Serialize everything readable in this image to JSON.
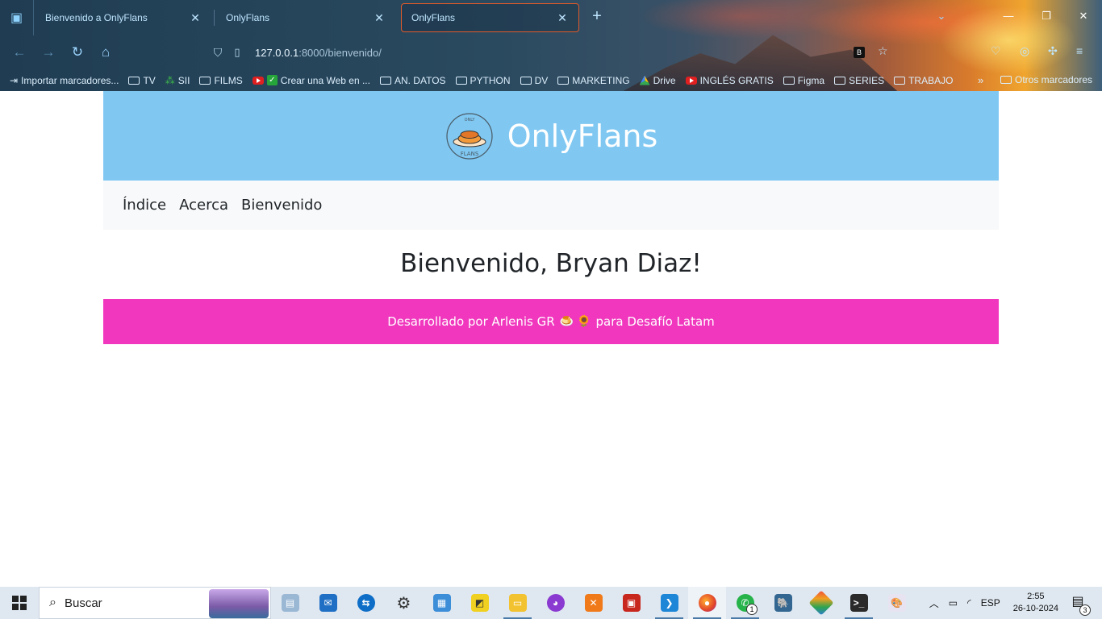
{
  "browser": {
    "tabs": [
      {
        "title": "Bienvenido a OnlyFlans",
        "active": false
      },
      {
        "title": "OnlyFlans",
        "active": false
      },
      {
        "title": "OnlyFlans",
        "active": true
      }
    ],
    "url_host": "127.0.0.1",
    "url_rest": ":8000/bienvenido/",
    "bookmarks": [
      {
        "label": "Importar marcadores...",
        "icon": "import-icon"
      },
      {
        "label": "TV",
        "icon": "folder-icon"
      },
      {
        "label": "SII",
        "icon": "sii-icon"
      },
      {
        "label": "FILMS",
        "icon": "folder-icon"
      },
      {
        "label": "Crear una Web en ...",
        "icon": "youtube-icon"
      },
      {
        "label": "AN. DATOS",
        "icon": "folder-icon"
      },
      {
        "label": "PYTHON",
        "icon": "folder-icon"
      },
      {
        "label": "DV",
        "icon": "folder-icon"
      },
      {
        "label": "MARKETING",
        "icon": "folder-icon"
      },
      {
        "label": "Drive",
        "icon": "drive-icon"
      },
      {
        "label": "INGLÉS GRATIS",
        "icon": "youtube-icon"
      },
      {
        "label": "Figma",
        "icon": "folder-icon"
      },
      {
        "label": "SERIES",
        "icon": "folder-icon"
      },
      {
        "label": "TRABAJO",
        "icon": "folder-icon"
      }
    ],
    "other_bookmarks": "Otros marcadores"
  },
  "site": {
    "brand": "OnlyFlans",
    "logo_top_text": "ONLY",
    "logo_bottom_text": "FLANS",
    "nav": [
      "Índice",
      "Acerca",
      "Bienvenido"
    ],
    "welcome": "Bienvenido, Bryan Diaz!",
    "footer_prefix": "Desarrollado por Arlenis GR",
    "footer_suffix": "para Desafío Latam"
  },
  "taskbar": {
    "search_placeholder": "Buscar",
    "whatsapp_badge": "1",
    "language": "ESP",
    "time": "2:55",
    "date": "26-10-2024",
    "notifications": "3"
  },
  "colors": {
    "header_bg": "#80c8f2",
    "footer_bg": "#f037be",
    "menu_bg": "#f8f9fa",
    "active_tab_border": "#e05a2a"
  }
}
